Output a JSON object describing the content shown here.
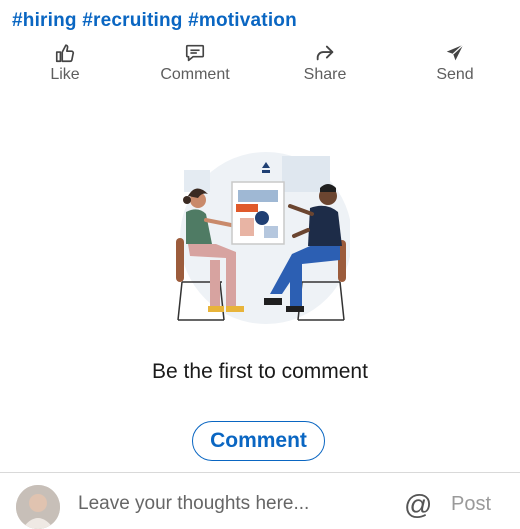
{
  "post": {
    "hashtags": "#hiring #recruiting #motivation"
  },
  "actions": {
    "like": {
      "label": "Like",
      "icon": "thumbs-up-icon"
    },
    "comment": {
      "label": "Comment",
      "icon": "comment-icon"
    },
    "share": {
      "label": "Share",
      "icon": "share-arrow-icon"
    },
    "send": {
      "label": "Send",
      "icon": "paper-plane-icon"
    }
  },
  "comments": {
    "empty_message": "Be the first to comment",
    "comment_button": "Comment"
  },
  "composer": {
    "placeholder": "Leave your thoughts here...",
    "mention_symbol": "@",
    "post_label": "Post"
  },
  "colors": {
    "accent": "#0a66c2",
    "action_text": "#5e5e5e"
  }
}
